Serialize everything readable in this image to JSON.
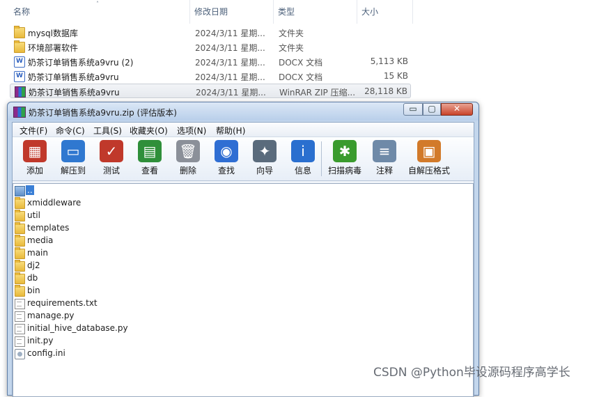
{
  "explorer": {
    "columns": {
      "name": "名称",
      "date": "修改日期",
      "type": "类型",
      "size": "大小"
    },
    "sort_indicator": "˄",
    "rows": [
      {
        "name": "mysql数据库",
        "date": "2024/3/11 星期...",
        "type": "文件夹",
        "size": "",
        "icon": "folder-icon"
      },
      {
        "name": "环境部署软件",
        "date": "2024/3/11 星期...",
        "type": "文件夹",
        "size": "",
        "icon": "folder-icon"
      },
      {
        "name": "奶茶订单销售系统a9vru (2)",
        "date": "2024/3/11 星期...",
        "type": "DOCX 文档",
        "size": "5,113 KB",
        "icon": "docx-icon"
      },
      {
        "name": "奶茶订单销售系统a9vru",
        "date": "2024/3/11 星期...",
        "type": "DOCX 文档",
        "size": "15 KB",
        "icon": "docx-icon"
      },
      {
        "name": "奶茶订单销售系统a9vru",
        "date": "2024/3/11 星期...",
        "type": "WinRAR ZIP 压缩...",
        "size": "28,118 KB",
        "icon": "winrar-icon",
        "selected": true
      }
    ]
  },
  "window": {
    "title": "奶茶订单销售系统a9vru.zip (评估版本)",
    "controls": {
      "minimize": "▭",
      "maximize": "▢",
      "close": "✕"
    }
  },
  "menu": [
    "文件(F)",
    "命令(C)",
    "工具(S)",
    "收藏夹(O)",
    "选项(N)",
    "帮助(H)"
  ],
  "toolbar": [
    {
      "label": "添加",
      "icon": "add-icon",
      "glyph": "▦",
      "color": "#c0392b"
    },
    {
      "label": "解压到",
      "icon": "extract-to-icon",
      "glyph": "▭",
      "color": "#2f78d0"
    },
    {
      "label": "测试",
      "icon": "test-icon",
      "glyph": "✓",
      "color": "#c0392b"
    },
    {
      "label": "查看",
      "icon": "view-icon",
      "glyph": "▤",
      "color": "#2f8f3a"
    },
    {
      "label": "删除",
      "icon": "delete-icon",
      "glyph": "🗑",
      "color": "#8b9099"
    },
    {
      "label": "查找",
      "icon": "find-icon",
      "glyph": "◉",
      "color": "#2f6ed3"
    },
    {
      "label": "向导",
      "icon": "wizard-icon",
      "glyph": "✦",
      "color": "#5a6b7c"
    },
    {
      "label": "信息",
      "icon": "info-icon",
      "glyph": "i",
      "color": "#2a6fcf"
    },
    {
      "label": "扫描病毒",
      "icon": "virus-scan-icon",
      "glyph": "✱",
      "color": "#3a9b2e"
    },
    {
      "label": "注释",
      "icon": "comment-icon",
      "glyph": "≡",
      "color": "#6f8aa8"
    },
    {
      "label": "自解压格式",
      "icon": "sfx-icon",
      "glyph": "▣",
      "color": "#d27a2a"
    }
  ],
  "files": [
    {
      "name": "..",
      "icon": "parent-folder-icon",
      "kind": "up"
    },
    {
      "name": "xmiddleware",
      "icon": "folder-icon",
      "kind": "folder"
    },
    {
      "name": "util",
      "icon": "folder-icon",
      "kind": "folder"
    },
    {
      "name": "templates",
      "icon": "folder-icon",
      "kind": "folder"
    },
    {
      "name": "media",
      "icon": "folder-icon",
      "kind": "folder"
    },
    {
      "name": "main",
      "icon": "folder-icon",
      "kind": "folder"
    },
    {
      "name": "dj2",
      "icon": "folder-icon",
      "kind": "folder"
    },
    {
      "name": "db",
      "icon": "folder-icon",
      "kind": "folder"
    },
    {
      "name": "bin",
      "icon": "folder-icon",
      "kind": "folder"
    },
    {
      "name": "requirements.txt",
      "icon": "text-file-icon",
      "kind": "file"
    },
    {
      "name": "manage.py",
      "icon": "text-file-icon",
      "kind": "file"
    },
    {
      "name": "initial_hive_database.py",
      "icon": "text-file-icon",
      "kind": "file"
    },
    {
      "name": "init.py",
      "icon": "text-file-icon",
      "kind": "file"
    },
    {
      "name": "config.ini",
      "icon": "settings-file-icon",
      "kind": "ini"
    }
  ],
  "watermark": "CSDN @Python毕设源码程序高学长"
}
